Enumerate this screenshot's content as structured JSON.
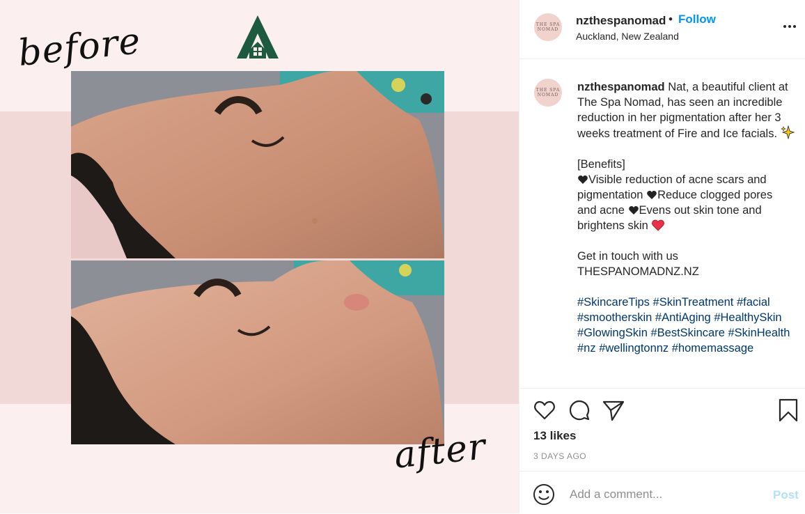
{
  "media": {
    "before_label": "before",
    "after_label": "after",
    "icons": [
      "logo-a-house-icon"
    ],
    "colors": {
      "background": "#fcefef",
      "band": "#f0d9d7",
      "logo": "#1d5a3f"
    }
  },
  "header": {
    "avatar_text": "THE SPA NOMAD",
    "username": "nzthespanomad",
    "separator": "•",
    "follow_label": "Follow",
    "location": "Auckland, New Zealand"
  },
  "caption": {
    "username": "nzthespanomad",
    "intro": "Nat, a beautiful client at The Spa Nomad, has seen an incredible reduction in her pigmentation after her 3 weeks treatment of Fire and Ice facials.",
    "benefits_heading": "[Benefits]",
    "benefit_1": "Visible reduction of acne scars and pigmentation",
    "benefit_2": "Reduce clogged pores and acne",
    "benefit_3": "Evens out skin tone and brightens skin",
    "contact_line": "Get in touch with us",
    "website": "THESPANOMADNZ.NZ",
    "hashtags": [
      "#SkincareTips",
      "#SkinTreatment",
      "#facial",
      "#smootherskin",
      "#AntiAging",
      "#HealthySkin",
      "#GlowingSkin",
      "#BestSkincare",
      "#SkinHealth",
      "#nz",
      "#wellingtonnz",
      "#homemassage"
    ]
  },
  "actions": {
    "icons": [
      "heart-icon",
      "comment-icon",
      "share-icon",
      "bookmark-icon"
    ]
  },
  "likes": "13 likes",
  "timestamp": "3 DAYS AGO",
  "comment": {
    "placeholder": "Add a comment...",
    "post_label": "Post"
  },
  "colors": {
    "accent": "#0095f6",
    "hashtag": "#00376b",
    "post_disabled": "#b2dffc"
  }
}
